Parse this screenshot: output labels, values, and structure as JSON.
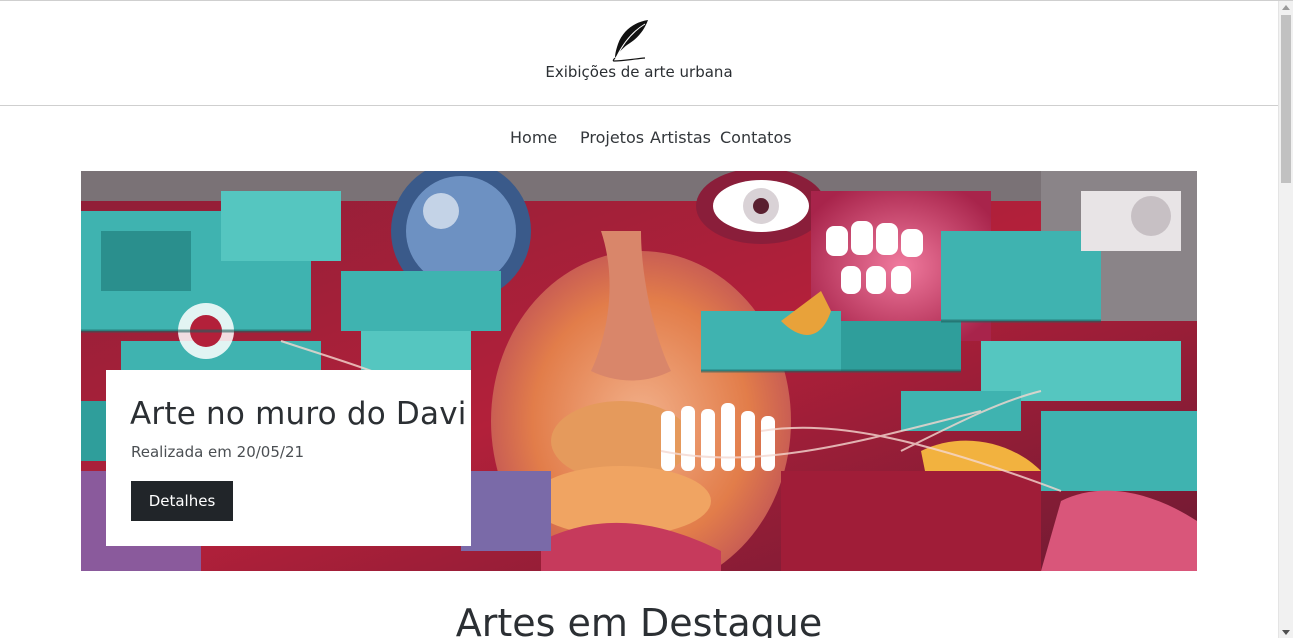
{
  "header": {
    "logo_icon": "feather-quill-icon",
    "site_title": "Exibições de arte urbana"
  },
  "nav": {
    "items": [
      {
        "label": "Home"
      },
      {
        "label": "Projetos"
      },
      {
        "label": "Artistas"
      },
      {
        "label": "Contatos"
      }
    ]
  },
  "hero": {
    "image": "graffiti-mural-image",
    "title": "Arte no muro do Davi",
    "date": "Realizada em 20/05/21",
    "button_label": "Detalhes"
  },
  "featured": {
    "title": "Artes em Destaque"
  },
  "colors": {
    "button_bg": "#212529",
    "text": "#2b2f33",
    "mural_teal": "#3fb3b0",
    "mural_red": "#b3203a",
    "mural_pink": "#d9567a",
    "mural_orange": "#e88a3c"
  }
}
